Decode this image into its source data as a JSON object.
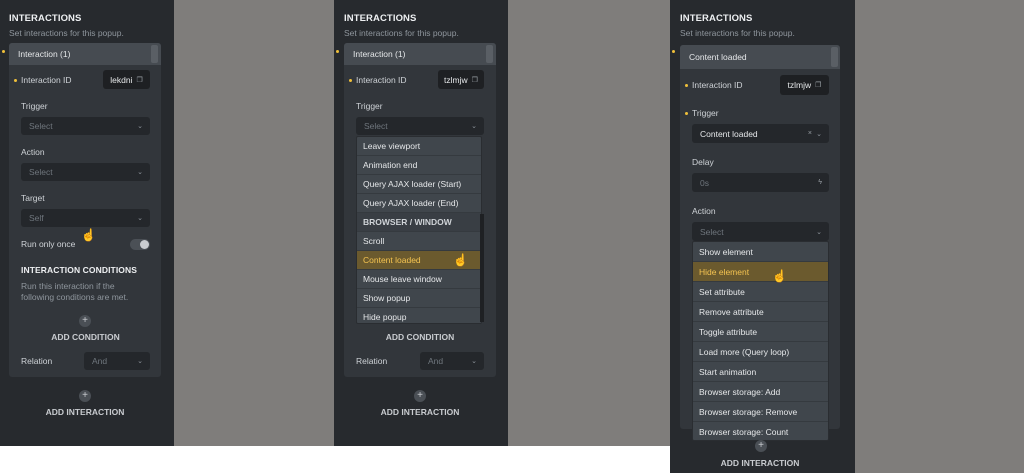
{
  "common": {
    "section_title": "INTERACTIONS",
    "section_subtitle": "Set interactions for this popup.",
    "interaction_id_label": "Interaction ID",
    "trigger_label": "Trigger",
    "action_label": "Action",
    "target_label": "Target",
    "select_placeholder": "Select",
    "add_interaction_label": "ADD INTERACTION",
    "add_condition_label": "ADD CONDITION",
    "relation_label": "Relation",
    "relation_value": "And"
  },
  "panel1": {
    "card_title": "Interaction (1)",
    "interaction_id": "lekdni",
    "target_value": "Self",
    "run_only_once_label": "Run only once",
    "conditions_title": "INTERACTION CONDITIONS",
    "conditions_desc_1": "Run this interaction if the",
    "conditions_desc_2": "following conditions are met."
  },
  "panel2": {
    "card_title": "Interaction (1)",
    "interaction_id": "tzlmjw",
    "trigger_dropdown": [
      {
        "label": "Leave viewport",
        "type": "item"
      },
      {
        "label": "Animation end",
        "type": "item"
      },
      {
        "label": "Query AJAX loader (Start)",
        "type": "item"
      },
      {
        "label": "Query AJAX loader (End)",
        "type": "item"
      },
      {
        "label": "BROWSER / WINDOW",
        "type": "group"
      },
      {
        "label": "Scroll",
        "type": "item"
      },
      {
        "label": "Content loaded",
        "type": "highlight"
      },
      {
        "label": "Mouse leave window",
        "type": "item"
      },
      {
        "label": "Show popup",
        "type": "item"
      },
      {
        "label": "Hide popup",
        "type": "item"
      }
    ]
  },
  "panel3": {
    "card_title": "Content loaded",
    "interaction_id": "tzlmjw",
    "trigger_value": "Content loaded",
    "delay_label": "Delay",
    "delay_placeholder": "0s",
    "action_dropdown": [
      {
        "label": "Show element",
        "type": "item"
      },
      {
        "label": "Hide element",
        "type": "highlight"
      },
      {
        "label": "Set attribute",
        "type": "item"
      },
      {
        "label": "Remove attribute",
        "type": "item"
      },
      {
        "label": "Toggle attribute",
        "type": "item"
      },
      {
        "label": "Load more (Query loop)",
        "type": "item"
      },
      {
        "label": "Start animation",
        "type": "item"
      },
      {
        "label": "Browser storage: Add",
        "type": "item"
      },
      {
        "label": "Browser storage: Remove",
        "type": "item"
      },
      {
        "label": "Browser storage: Count",
        "type": "item"
      }
    ]
  },
  "colors": {
    "panel_bg": "#272a2e",
    "accent": "#f0c03a",
    "highlight_bg": "#6b5a2e",
    "highlight_text": "#f5c451",
    "backdrop": "#7f7d7b"
  }
}
